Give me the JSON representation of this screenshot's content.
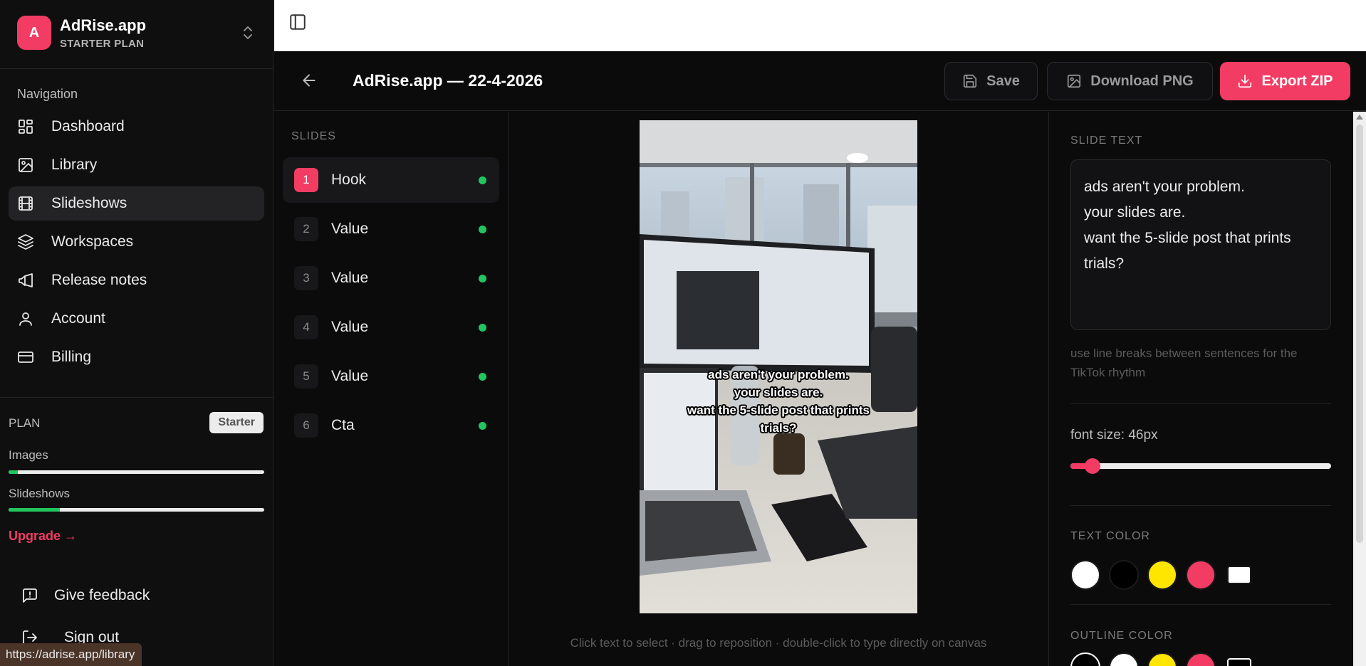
{
  "brand": {
    "logo_letter": "A",
    "name": "AdRise.app",
    "plan": "STARTER PLAN",
    "accent": "#f23c64"
  },
  "nav": {
    "heading": "Navigation",
    "items": [
      {
        "label": "Dashboard",
        "icon": "dashboard-icon"
      },
      {
        "label": "Library",
        "icon": "image-icon"
      },
      {
        "label": "Slideshows",
        "icon": "film-icon",
        "active": true
      },
      {
        "label": "Workspaces",
        "icon": "layers-icon"
      },
      {
        "label": "Release notes",
        "icon": "megaphone-icon"
      },
      {
        "label": "Account",
        "icon": "user-icon"
      },
      {
        "label": "Billing",
        "icon": "credit-card-icon"
      }
    ]
  },
  "plan": {
    "label": "PLAN",
    "badge": "Starter",
    "usage": [
      {
        "label": "Images",
        "fraction": 0.035
      },
      {
        "label": "Slideshows",
        "fraction": 0.2
      }
    ],
    "upgrade": "Upgrade →"
  },
  "footer": {
    "feedback": "Give feedback",
    "sign_out": "Sign out"
  },
  "status_url": "https://adrise.app/library",
  "editor": {
    "title": "AdRise.app — 22-4-2026",
    "save": "Save",
    "download": "Download PNG",
    "export": "Export ZIP"
  },
  "slides": {
    "heading": "SLIDES",
    "items": [
      {
        "num": "1",
        "label": "Hook",
        "active": true,
        "status": "#22c55e"
      },
      {
        "num": "2",
        "label": "Value",
        "status": "#22c55e"
      },
      {
        "num": "3",
        "label": "Value",
        "status": "#22c55e"
      },
      {
        "num": "4",
        "label": "Value",
        "status": "#22c55e"
      },
      {
        "num": "5",
        "label": "Value",
        "status": "#22c55e"
      },
      {
        "num": "6",
        "label": "Cta",
        "status": "#22c55e"
      }
    ]
  },
  "canvas": {
    "overlay_text": "ads aren't your problem.\nyour slides are.\nwant the 5-slide post that prints\ntrials?",
    "hint": "Click text to select · drag to reposition · double-click to type directly on canvas"
  },
  "props": {
    "slide_text_heading": "SLIDE TEXT",
    "slide_text": "ads aren't your problem.\nyour slides are.\nwant the 5-slide post that prints\ntrials?",
    "help": "use line breaks between sentences for the TikTok rhythm",
    "font_size_label": "font size: 46px",
    "font_size_fraction": 0.085,
    "text_color_heading": "TEXT COLOR",
    "text_colors": [
      "#ffffff",
      "#000000",
      "#ffe600",
      "#f23c64",
      "#ffffff"
    ],
    "outline_color_heading": "OUTLINE COLOR",
    "outline_colors": [
      "#000000",
      "#ffffff",
      "#ffe600",
      "#f23c64",
      "#000000"
    ]
  }
}
